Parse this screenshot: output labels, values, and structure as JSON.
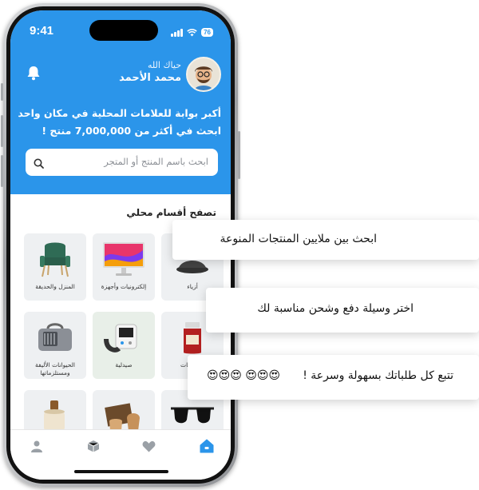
{
  "status_bar": {
    "time": "9:41",
    "battery": "76"
  },
  "header": {
    "greeting": "حياك الله",
    "user_name": "محمد الأحمد",
    "tagline_line1": "أكبر بوابة للعلامات المحلية في مكان واحد",
    "tagline_line2": "ابحث في أكثر من 7,000,000 منتج !"
  },
  "search": {
    "placeholder": "ابحث باسم المنتج أو المتجر"
  },
  "categories_section": {
    "title": "تصفح أقسام محلي"
  },
  "categories": [
    {
      "label": "المنزل والحديقة",
      "icon": "armchair-icon"
    },
    {
      "label": "إلكترونيات وأجهزة",
      "icon": "monitor-icon"
    },
    {
      "label": "أزياء",
      "icon": "fashion-icon"
    },
    {
      "label": "الحيوانات الأليفة ومستلزماتها",
      "icon": "pet-carrier-icon"
    },
    {
      "label": "صيدلية",
      "icon": "blood-pressure-monitor-icon"
    },
    {
      "label": "مشروبات",
      "icon": "jam-jar-icon"
    },
    {
      "label": "",
      "icon": "cosmetics-icon"
    },
    {
      "label": "",
      "icon": "crafts-icon"
    },
    {
      "label": "",
      "icon": "sunglasses-icon"
    }
  ],
  "tabs": [
    {
      "name": "profile",
      "icon": "user-icon"
    },
    {
      "name": "orders",
      "icon": "box-icon"
    },
    {
      "name": "favorites",
      "icon": "heart-icon"
    },
    {
      "name": "home",
      "icon": "home-icon",
      "active": true
    }
  ],
  "callouts": {
    "one": "ابحث بين ملايين المنتجات المنوعة",
    "two": "اختر وسيلة دفع وشحن مناسبة لك",
    "three_text": "تتبع  كل طلباتك بسهولة وسرعة !",
    "three_emoji": "😍😍😍 😍😍😍"
  },
  "colors": {
    "brand": "#2b95ea",
    "tile": "#eef0f2"
  }
}
